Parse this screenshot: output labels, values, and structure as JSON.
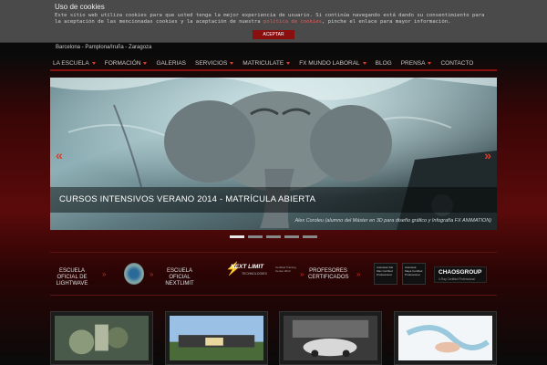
{
  "cookie": {
    "title": "Uso de cookies",
    "text_before": "Este sitio web utiliza cookies para que usted tenga la mejor experiencia de usuario. Si continúa navegando está dando su consentimiento para la aceptación de las mencionadas cookies y la aceptación de nuestra ",
    "link": "política de cookies",
    "text_after": ", pinche el enlace para mayor información.",
    "accept_label": "ACEPTAR"
  },
  "header": {
    "cities": "Barcelona - Pamplona/Iruña - Zaragoza"
  },
  "nav": {
    "items": [
      {
        "label": "LA ESCUELA",
        "dropdown": true
      },
      {
        "label": "FORMACIÓN",
        "dropdown": true
      },
      {
        "label": "GALERIAS",
        "dropdown": false
      },
      {
        "label": "SERVICIOS",
        "dropdown": true
      },
      {
        "label": "MATRICULATE",
        "dropdown": true
      },
      {
        "label": "FX MUNDO LABORAL",
        "dropdown": true
      },
      {
        "label": "BLOG",
        "dropdown": false
      },
      {
        "label": "PRENSA",
        "dropdown": true
      },
      {
        "label": "CONTACTO",
        "dropdown": false
      }
    ]
  },
  "slider": {
    "prev_glyph": "«",
    "next_glyph": "»",
    "caption": "CURSOS INTENSIVOS VERANO 2014 - MATRÍCULA ABIERTA",
    "credit": "Alex Coroleu (alumno del Máster en 3D para diseño gráfico y Infografía FX ANIMATION)",
    "active_slide": 1,
    "slide_count": 5
  },
  "certs": {
    "lightwave": "ESCUELA OFICIAL DE LIGHTWAVE",
    "nextlimit_label": "ESCUELA OFICIAL NEXTLIMIT",
    "nextlimit_logo": "NEXT LIMIT",
    "nextlimit_logo_sub": "TECHNOLOGIES",
    "nextlimit_badge": "Certified Training Center 2013",
    "profesores": "PROFESORES CERTIFICADOS",
    "autodesk_1": "Autodesk 3ds Max Certified Professional",
    "autodesk_2": "Autodesk Maya Certified Professional",
    "chaos_title": "CHAOSGROUP",
    "chaos_sub": "V-Ray Certified Professional"
  },
  "colors": {
    "accent": "#8a1010",
    "caret": "#e03a2a"
  }
}
